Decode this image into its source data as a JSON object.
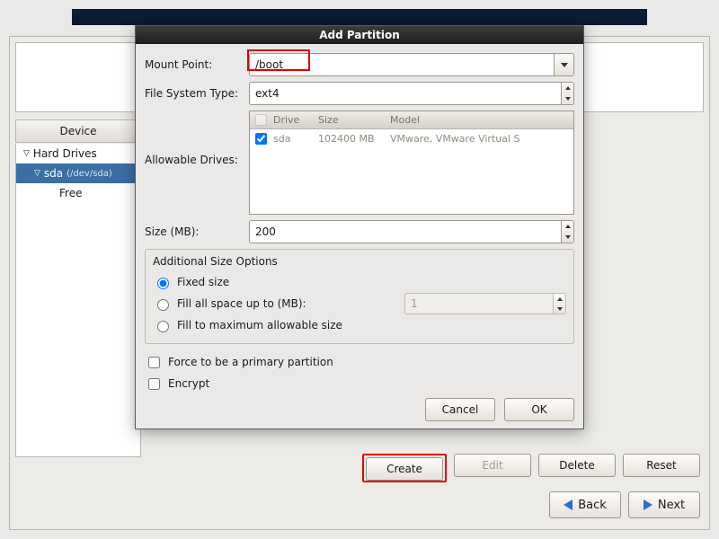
{
  "tree": {
    "header": "Device",
    "hard_drives": "Hard Drives",
    "sda": "sda",
    "sda_path": "(/dev/sda)",
    "free": "Free"
  },
  "actions": {
    "create": "Create",
    "edit": "Edit",
    "delete": "Delete",
    "reset": "Reset",
    "back": "Back",
    "next": "Next"
  },
  "dialog": {
    "title": "Add Partition",
    "mount_point_label": "Mount Point:",
    "mount_point_value": "/boot",
    "fs_type_label": "File System Type:",
    "fs_type_value": "ext4",
    "allowable_label": "Allowable Drives:",
    "size_label": "Size (MB):",
    "size_value": "200",
    "drive_table": {
      "head_drive": "Drive",
      "head_size": "Size",
      "head_model": "Model",
      "row": {
        "drive": "sda",
        "size": "102400 MB",
        "model": "VMware, VMware Virtual S"
      }
    },
    "additional": {
      "title": "Additional Size Options",
      "fixed": "Fixed size",
      "fill_up_to": "Fill all space up to (MB):",
      "fill_up_to_val": "1",
      "fill_max": "Fill to maximum allowable size"
    },
    "force_primary": "Force to be a primary partition",
    "encrypt": "Encrypt",
    "cancel": "Cancel",
    "ok": "OK"
  }
}
